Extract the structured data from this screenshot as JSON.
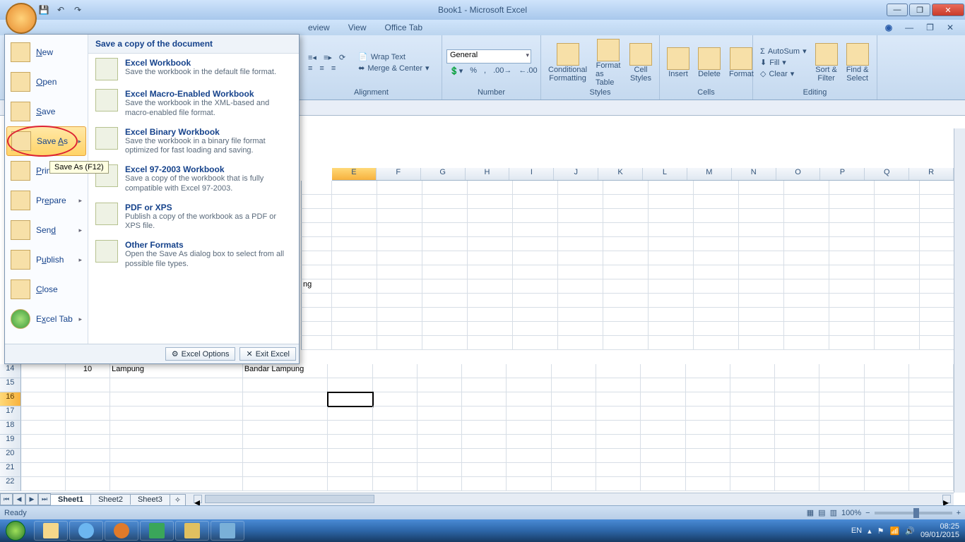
{
  "window": {
    "title": "Book1 - Microsoft Excel"
  },
  "tabs": {
    "review": "eview",
    "view": "View",
    "officetab": "Office Tab"
  },
  "ribbon": {
    "alignment": {
      "wrap": "Wrap Text",
      "merge": "Merge & Center",
      "label": "Alignment"
    },
    "number": {
      "format": "General",
      "label": "Number"
    },
    "styles": {
      "cond": "Conditional",
      "cond2": "Formatting",
      "fat": "Format",
      "fat2": "as Table",
      "cs": "Cell",
      "cs2": "Styles",
      "label": "Styles"
    },
    "cells": {
      "ins": "Insert",
      "del": "Delete",
      "fmt": "Format",
      "label": "Cells"
    },
    "editing": {
      "asum": "AutoSum",
      "fill": "Fill",
      "clear": "Clear",
      "sort": "Sort &",
      "sort2": "Filter",
      "find": "Find &",
      "find2": "Select",
      "label": "Editing"
    }
  },
  "office_menu": {
    "left": {
      "new": "New",
      "open": "Open",
      "save": "Save",
      "saveas": "Save As",
      "print": "Print",
      "prepare": "Prepare",
      "send": "Send",
      "publish": "Publish",
      "close": "Close",
      "exceltab": "Excel Tab"
    },
    "tooltip": "Save As (F12)",
    "right_header": "Save a copy of the document",
    "opts": [
      {
        "t": "Excel Workbook",
        "d": "Save the workbook in the default file format."
      },
      {
        "t": "Excel Macro-Enabled Workbook",
        "d": "Save the workbook in the XML-based and macro-enabled file format."
      },
      {
        "t": "Excel Binary Workbook",
        "d": "Save the workbook in a binary file format optimized for fast loading and saving."
      },
      {
        "t": "Excel 97-2003 Workbook",
        "d": "Save a copy of the workbook that is fully compatible with Excel 97-2003."
      },
      {
        "t": "PDF or XPS",
        "d": "Publish a copy of the workbook as a PDF or XPS file."
      },
      {
        "t": "Other Formats",
        "d": "Open the Save As dialog box to select from all possible file types."
      }
    ],
    "footer": {
      "options": "Excel Options",
      "exit": "Exit Excel"
    }
  },
  "columns": [
    "E",
    "F",
    "G",
    "H",
    "I",
    "J",
    "K",
    "L",
    "M",
    "N",
    "O",
    "P",
    "Q",
    "R"
  ],
  "data_row": {
    "num": "14",
    "b": "10",
    "c": "Lampung",
    "d": "Bandar Lampung"
  },
  "partial_cell": "ng",
  "sheets": {
    "s1": "Sheet1",
    "s2": "Sheet2",
    "s3": "Sheet3"
  },
  "status": {
    "ready": "Ready",
    "zoom": "100%"
  },
  "tray": {
    "lang": "EN",
    "time": "08:25",
    "date": "09/01/2015"
  }
}
